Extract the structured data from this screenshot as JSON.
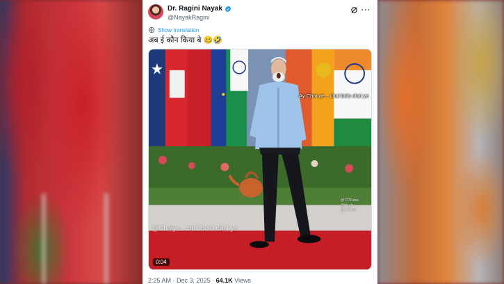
{
  "author": {
    "name": "Dr. Ragini Nayak",
    "handle": "@NayakRagini"
  },
  "translate_label": "Show translation",
  "tweet_text": "अब ई कौन किया बे 🥴🤣",
  "media": {
    "caption": "Ay Chai ye... chai bolo chai ye",
    "watermark": "@Chaiye...chai bolo chai ye",
    "corner_tags": [
      "@777Pulse",
      "@rkr_in",
      "@777Live"
    ],
    "duration": "0:04"
  },
  "meta": {
    "time": "2:25 AM",
    "date": "Dec 3, 2025",
    "views_count": "64.1K",
    "views_label": "Views"
  },
  "icons": {
    "verified": "verified-badge-icon",
    "grok": "grok-icon",
    "more": "more-icon",
    "translate": "translate-icon"
  },
  "colors": {
    "accent": "#1d9bf0",
    "text": "#0f1419",
    "muted": "#536471"
  }
}
